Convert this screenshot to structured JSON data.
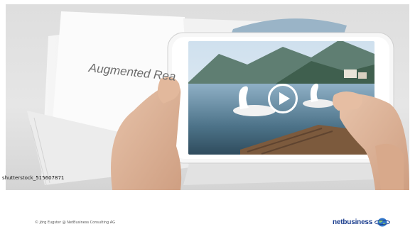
{
  "slide": {
    "book_text": "Augmented Rea",
    "image_credit": "shutterstock_515607871",
    "video": {
      "play_icon": "play-icon"
    }
  },
  "footer": {
    "copyright": "© Jörg Eugster @ NetBusiness Consulting AG",
    "brand_name": "netbusiness",
    "brand_icon": "globe-icon",
    "brand_color": "#1d3f8f"
  }
}
